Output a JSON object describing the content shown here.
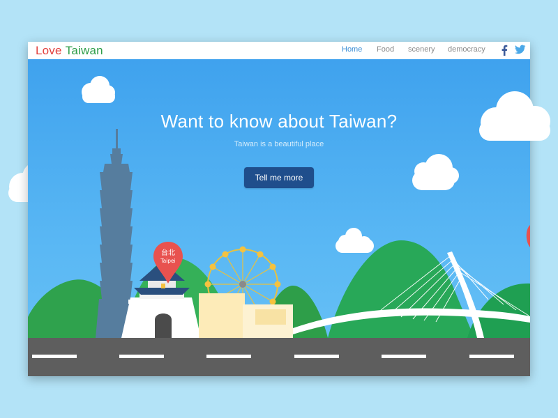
{
  "navbar": {
    "logo_love": "Love",
    "logo_taiwan": "Taiwan",
    "links": [
      "Home",
      "Food",
      "scenery",
      "democracy"
    ],
    "active_link": "Home",
    "social_icons": [
      "facebook-icon",
      "twitter-icon"
    ]
  },
  "hero": {
    "title": "Want to know about Taiwan?",
    "subtitle": "Taiwan is a beautiful place",
    "cta_label": "Tell me more"
  },
  "map_pin": {
    "line1": "台北",
    "line2": "Taipei"
  },
  "colors": {
    "sky_top": "#3fa2ee",
    "sky_bottom": "#6ac2f6",
    "button": "#1f4e8c",
    "logo_red": "#e2403e",
    "logo_green": "#2f9e4a",
    "active_link": "#3e8fd6",
    "road": "#5e5e5e",
    "pin": "#e8524f"
  }
}
